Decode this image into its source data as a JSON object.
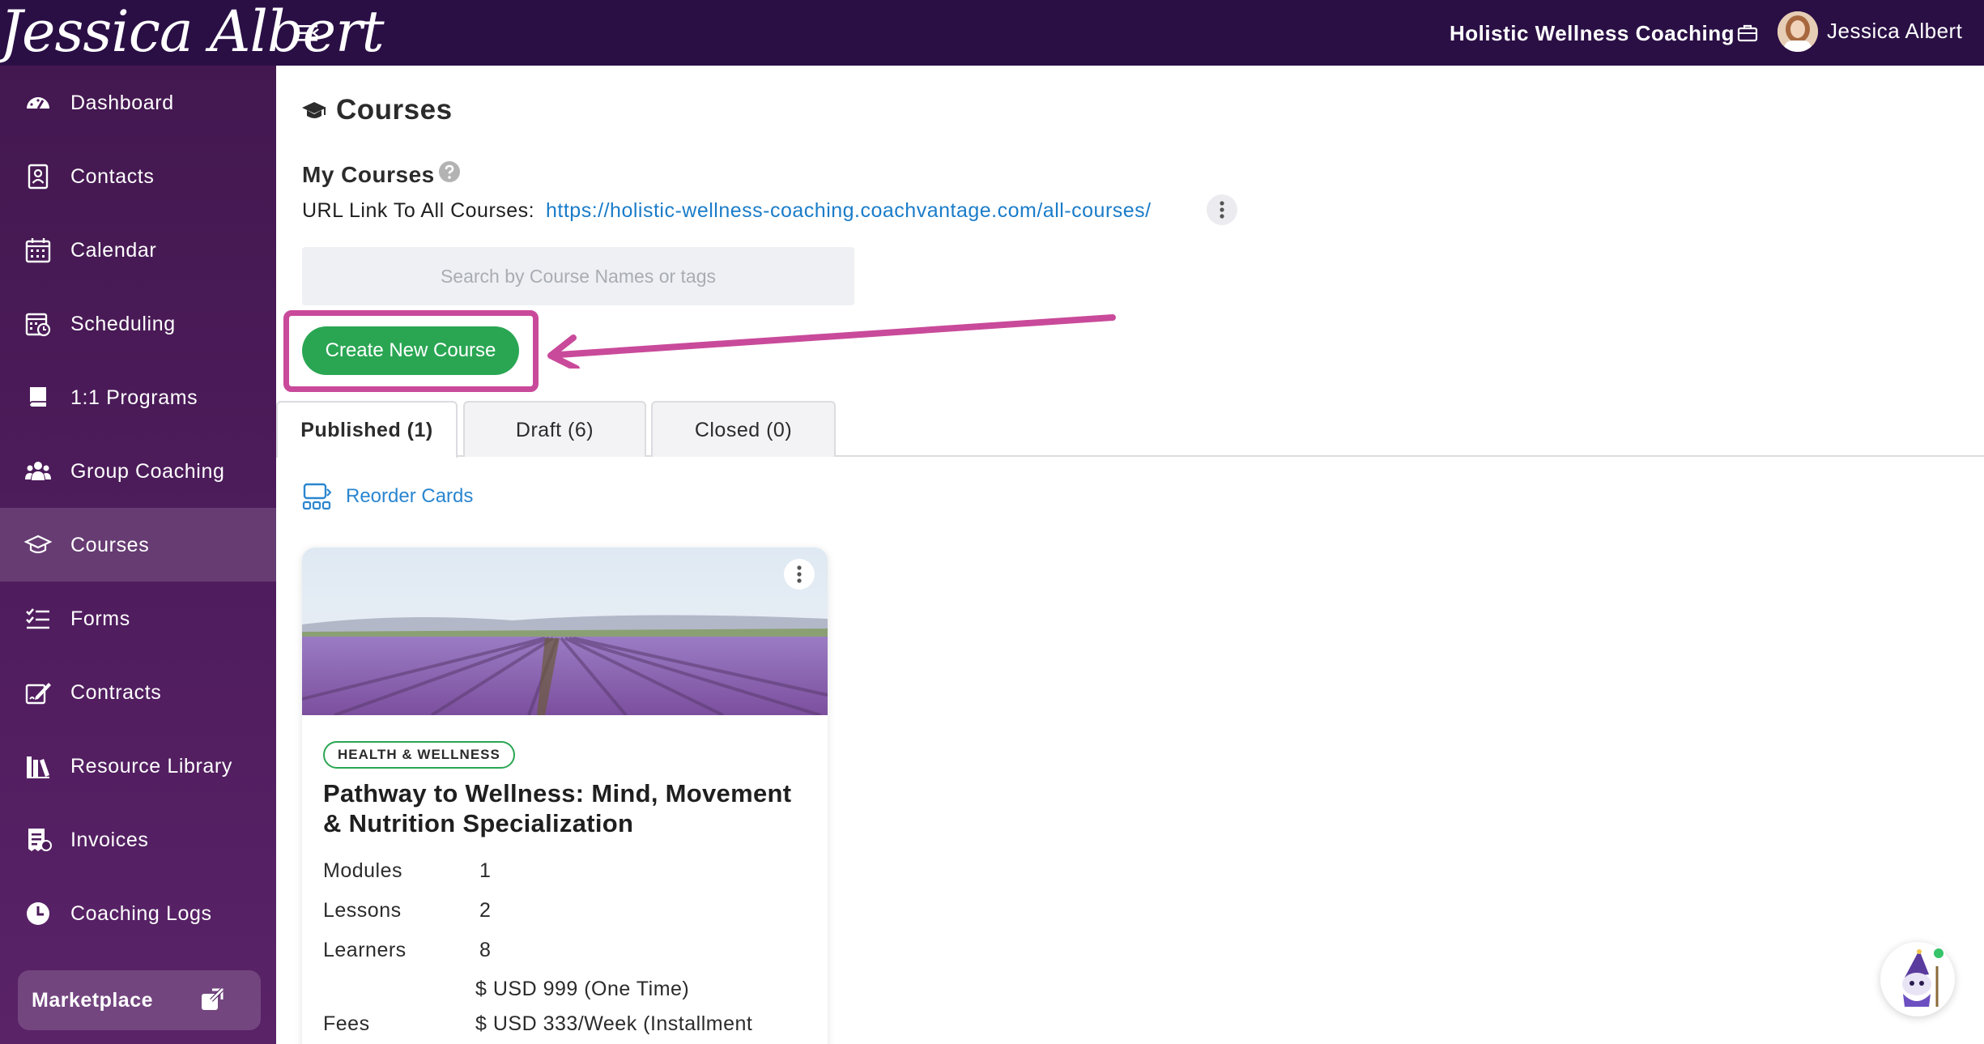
{
  "header": {
    "logo_text": "Jessica Albert",
    "org_name": "Holistic Wellness Coaching",
    "user_name": "Jessica Albert"
  },
  "sidebar": {
    "items": [
      {
        "label": "Dashboard",
        "icon": "dashboard-gauge-icon"
      },
      {
        "label": "Contacts",
        "icon": "contacts-book-icon"
      },
      {
        "label": "Calendar",
        "icon": "calendar-icon"
      },
      {
        "label": "Scheduling",
        "icon": "calendar-clock-icon"
      },
      {
        "label": "1:1 Programs",
        "icon": "book-icon"
      },
      {
        "label": "Group Coaching",
        "icon": "users-group-icon"
      },
      {
        "label": "Courses",
        "icon": "graduation-cap-icon",
        "active": true
      },
      {
        "label": "Forms",
        "icon": "checklist-icon"
      },
      {
        "label": "Contracts",
        "icon": "signature-pen-icon"
      },
      {
        "label": "Resource Library",
        "icon": "library-books-icon"
      },
      {
        "label": "Invoices",
        "icon": "invoice-icon"
      },
      {
        "label": "Coaching Logs",
        "icon": "clock-icon"
      }
    ],
    "marketplace_label": "Marketplace"
  },
  "main": {
    "title": "Courses",
    "section_title": "My Courses",
    "url_label": "URL Link To All Courses:",
    "url": "https://holistic-wellness-coaching.coachvantage.com/all-courses/",
    "search_placeholder": "Search by Course Names or tags",
    "create_button": "Create New Course",
    "tabs": [
      {
        "label": "Published (1)",
        "active": true
      },
      {
        "label": "Draft (6)"
      },
      {
        "label": "Closed (0)"
      }
    ],
    "reorder_label": "Reorder Cards"
  },
  "card": {
    "category": "HEALTH & WELLNESS",
    "title": "Pathway to Wellness: Mind, Movement & Nutrition Specialization",
    "stats": [
      {
        "label": "Modules",
        "value": "1"
      },
      {
        "label": "Lessons",
        "value": "2"
      },
      {
        "label": "Learners",
        "value": "8"
      }
    ],
    "fees_label": "Fees",
    "fee_one_time": "$ USD 999 (One Time)",
    "fee_installment": "$ USD 333/Week (Installment"
  },
  "colors": {
    "topbar": "#2a0f45",
    "sidebar": "#4e1c5c",
    "primary_button": "#2aa653",
    "link": "#1a7cc9",
    "annotation": "#c94a9a"
  }
}
